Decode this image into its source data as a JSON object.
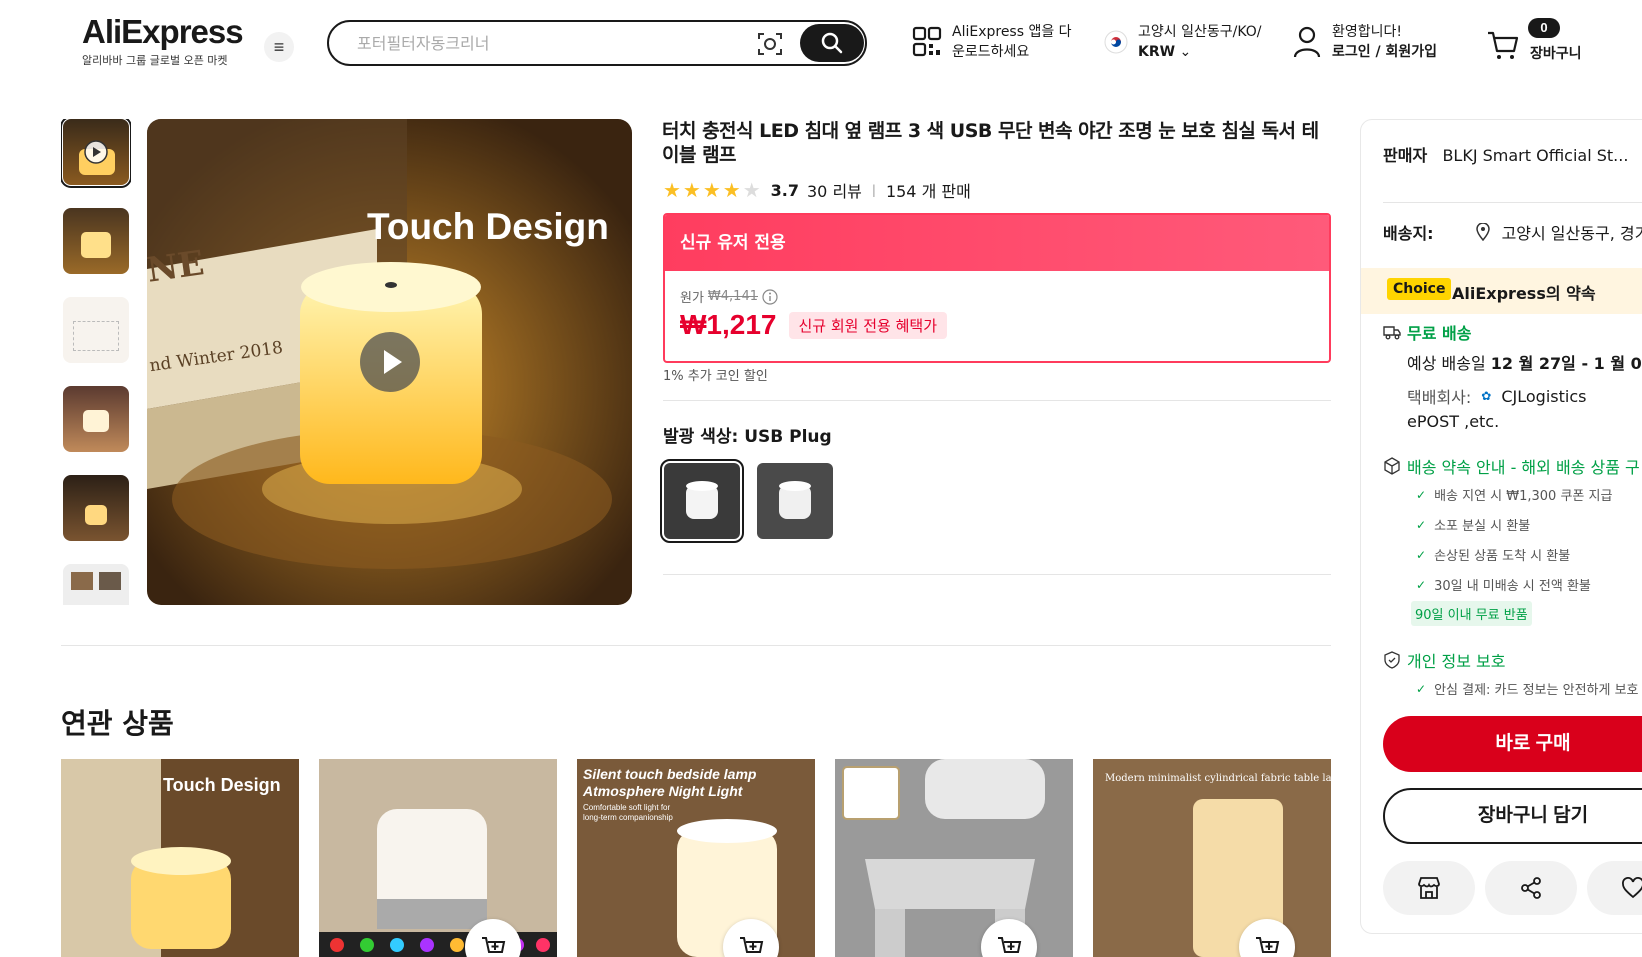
{
  "header": {
    "logo_text": "AliExpress",
    "logo_sub": "알리바바 그룹 글로벌 오픈 마켓",
    "menu_icon": "hamburger-icon",
    "search_placeholder": "포터필터자동크리너",
    "app_line1": "AliExpress 앱을 다",
    "app_line2": "운로드하세요",
    "region_line1": "고양시 일산동구/KO/",
    "region_line2": "KRW",
    "account_line1": "환영합니다!",
    "account_line2": "로그인 / 회원가입",
    "cart_count": "0",
    "cart_label": "장바구니"
  },
  "product": {
    "title": "터치 충전식 LED 침대 옆 램프 3 색 USB 무단 변속 야간 조명 눈 보호 침실 독서 테이블 램프",
    "rating": "3.7",
    "rating_value": 3.7,
    "reviews": "30 리뷰",
    "sold": "154 개 판매",
    "main_image_text": "Touch Design",
    "main_image_book_text1": "NE",
    "main_image_book_text2": "nd Winter 2018",
    "promo_header": "신규 유저 전용",
    "orig_label": "원가",
    "orig_price": "₩4,141",
    "price": "₩1,217",
    "price_tag": "신규 회원 전용 혜택가",
    "coin_text": "1% 추가 코인 할인",
    "color_label": "발광 색상: USB Plug"
  },
  "related": {
    "title": "연관 상품",
    "card1_text": "Touch Design",
    "card3_line1": "Silent touch bedside lamp",
    "card3_line2": "Atmosphere Night Light",
    "card3_line3": "Comfortable soft light for",
    "card3_line4": "long-term companionship",
    "card5_text": "Modern minimalist cylindrical fabric table lamp"
  },
  "side": {
    "seller_label": "판매자",
    "seller_name": "BLKJ Smart Official St...",
    "ship_label": "배송지:",
    "ship_value": "고양시 일산동구, 경기도",
    "choice_tag": "Choice",
    "choice_text": "AliExpress의 약속",
    "free_ship": "무료 배송",
    "est_prefix": "예상 배송일",
    "est_dates": "12 월 27일 - 1 월 0",
    "courier_label": "택배회사:",
    "courier_name": "CJLogistics",
    "courier_more": "ePOST ,etc.",
    "promise_title": "배송 약속 안내 - 해외 배송 상품 구",
    "checks": [
      "배송 지연 시 ₩1,300 쿠폰 지급",
      "소포 분실 시 환불",
      "손상된 상품 도착 시 환불",
      "30일 내 미배송 시 전액 환불"
    ],
    "return_badge": "90일 이내 무료 반품",
    "privacy_title": "개인 정보 보호",
    "privacy_check": "안심 결제: 카드 정보는 안전하게 보호",
    "buy_now": "바로 구매",
    "add_cart": "장바구니 담기"
  },
  "colors": {
    "accent": "#e62e04",
    "promo_red": "#ff3b5c",
    "buy_red": "#d9001b",
    "green": "#00a046",
    "star": "#fbbf24"
  }
}
